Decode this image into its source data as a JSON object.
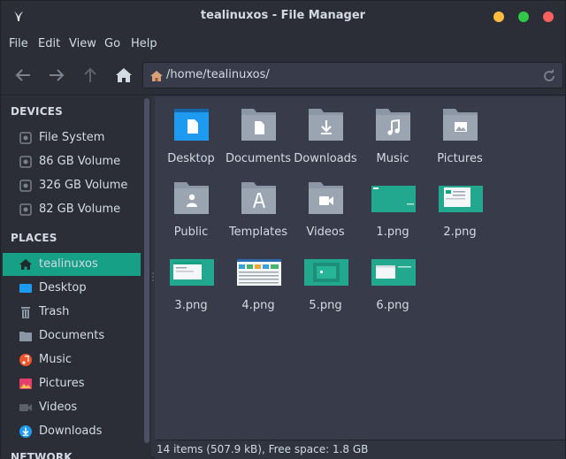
{
  "window": {
    "title": "tealinuxos - File Manager"
  },
  "menu": [
    "File",
    "Edit",
    "View",
    "Go",
    "Help"
  ],
  "location": {
    "path": "/home/tealinuxos/"
  },
  "sidebar": {
    "devices_heading": "DEVICES",
    "devices": [
      {
        "label": "File System",
        "icon": "drive-icon"
      },
      {
        "label": "86 GB Volume",
        "icon": "drive-icon"
      },
      {
        "label": "326 GB Volume",
        "icon": "drive-icon"
      },
      {
        "label": "82 GB Volume",
        "icon": "drive-icon"
      }
    ],
    "places_heading": "PLACES",
    "places": [
      {
        "label": "tealinuxos",
        "icon": "home-icon",
        "active": true
      },
      {
        "label": "Desktop",
        "icon": "desktop-icon"
      },
      {
        "label": "Trash",
        "icon": "trash-icon"
      },
      {
        "label": "Documents",
        "icon": "documents-icon"
      },
      {
        "label": "Music",
        "icon": "music-icon"
      },
      {
        "label": "Pictures",
        "icon": "pictures-icon"
      },
      {
        "label": "Videos",
        "icon": "videos-icon"
      },
      {
        "label": "Downloads",
        "icon": "downloads-icon"
      }
    ],
    "network_heading": "NETWORK"
  },
  "files": [
    {
      "name": "Desktop",
      "icon": "desktop-folder-icon"
    },
    {
      "name": "Documents",
      "icon": "documents-folder-icon"
    },
    {
      "name": "Downloads",
      "icon": "downloads-folder-icon"
    },
    {
      "name": "Music",
      "icon": "music-folder-icon"
    },
    {
      "name": "Pictures",
      "icon": "pictures-folder-icon"
    },
    {
      "name": "Public",
      "icon": "public-folder-icon"
    },
    {
      "name": "Templates",
      "icon": "templates-folder-icon"
    },
    {
      "name": "Videos",
      "icon": "videos-folder-icon"
    },
    {
      "name": "1.png",
      "icon": "image-thumbnail"
    },
    {
      "name": "2.png",
      "icon": "image-thumbnail"
    },
    {
      "name": "3.png",
      "icon": "image-thumbnail"
    },
    {
      "name": "4.png",
      "icon": "image-thumbnail"
    },
    {
      "name": "5.png",
      "icon": "image-thumbnail"
    },
    {
      "name": "6.png",
      "icon": "image-thumbnail"
    }
  ],
  "status": {
    "text": "14 items (507.9 kB), Free space: 1.8 GB"
  },
  "colors": {
    "accent": "#16a085",
    "folder": "#8b97a5",
    "desktop_folder": "#1e9bf0",
    "window_bg": "#383c4a"
  }
}
